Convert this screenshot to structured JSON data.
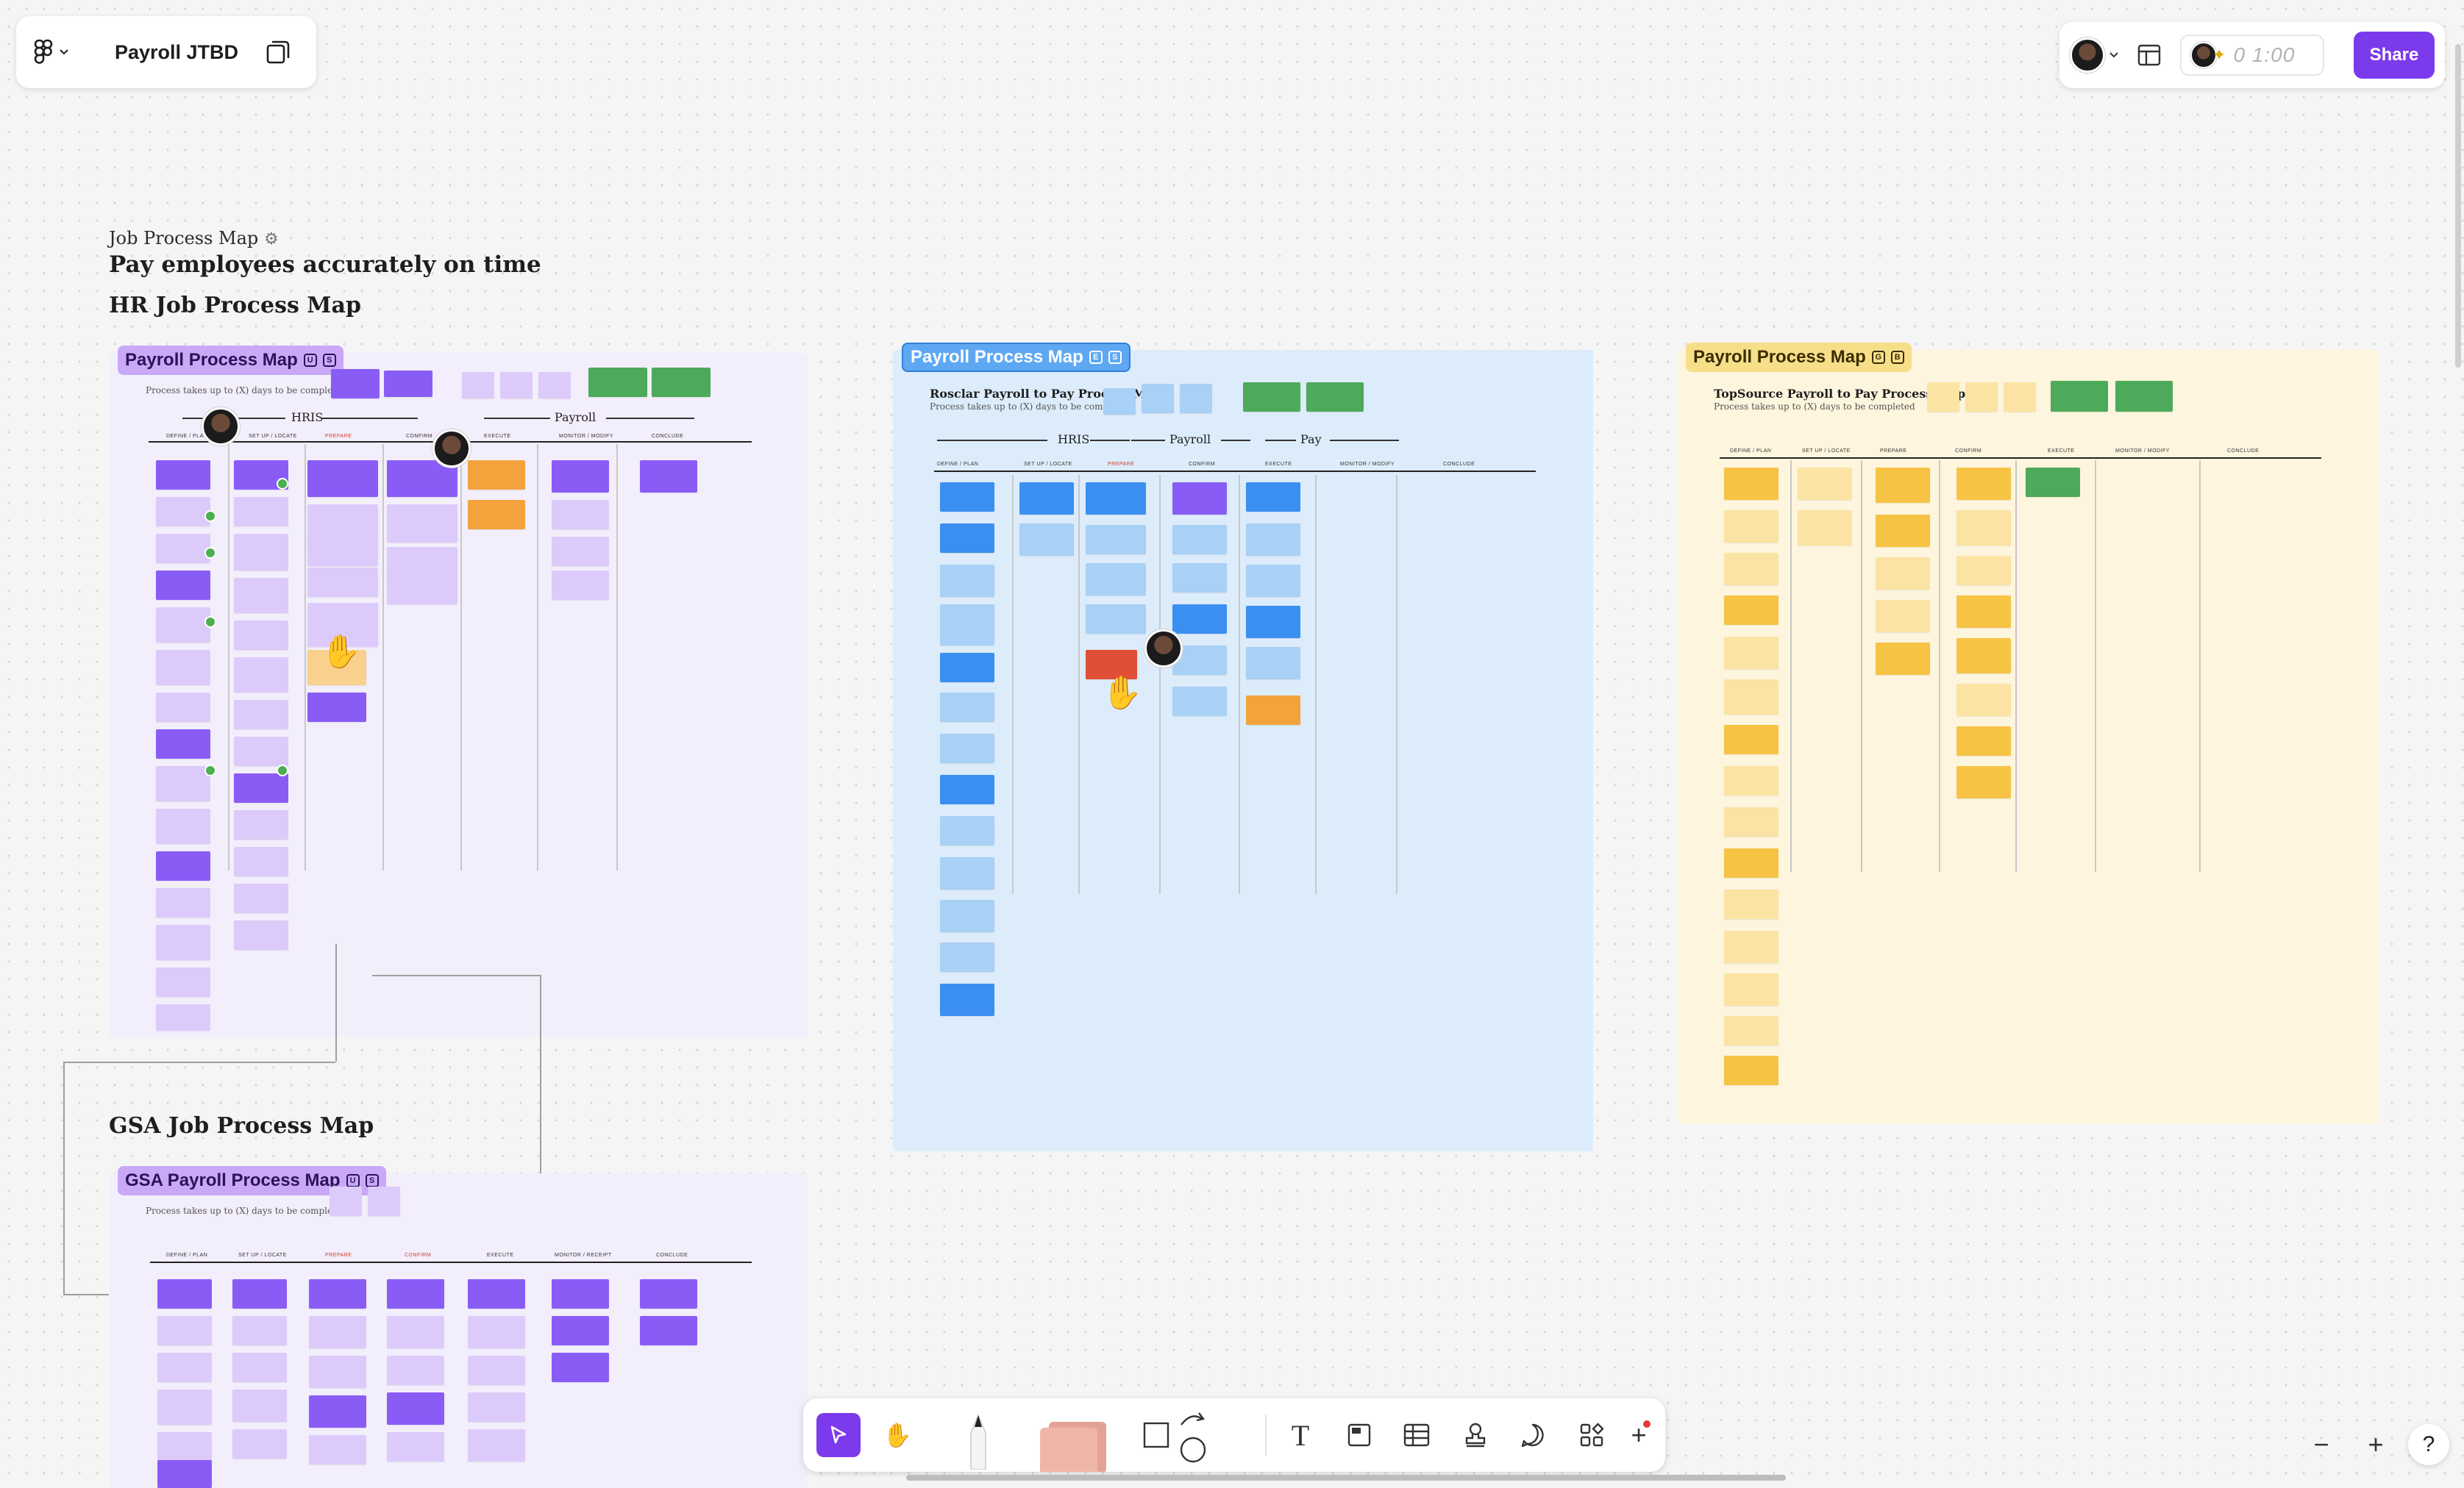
{
  "header": {
    "file_title": "Payroll JTBD",
    "share_label": "Share",
    "timer": "0 1:00"
  },
  "board": {
    "eyebrow": "Job Process Map",
    "headline": "Pay employees accurately on time",
    "hr_heading": "HR Job Process Map",
    "gsa_heading": "GSA Job Process Map"
  },
  "sections": {
    "hr": {
      "label": "Payroll Process Map",
      "keys": [
        "U",
        "S"
      ],
      "subtitle": "Process takes up to (X) days to be completed",
      "bands": [
        "HRIS",
        "Payroll"
      ],
      "stages": [
        "DEFINE / PLAN",
        "SET UP / LOCATE",
        "PREPARE",
        "CONFIRM",
        "EXECUTE",
        "MONITOR / MODIFY",
        "CONCLUDE"
      ]
    },
    "rosclar": {
      "label": "Payroll Process Map",
      "keys": [
        "E",
        "S"
      ],
      "title": "Rosclar Payroll to Pay Process Map",
      "subtitle": "Process takes up to (X) days to be completed",
      "bands": [
        "HRIS",
        "Payroll",
        "Pay"
      ],
      "stages": [
        "DEFINE / PLAN",
        "SET UP / LOCATE",
        "PREPARE",
        "CONFIRM",
        "EXECUTE",
        "MONITOR / MODIFY",
        "CONCLUDE"
      ]
    },
    "topsource": {
      "label": "Payroll Process Map",
      "keys": [
        "G",
        "B"
      ],
      "title": "TopSource Payroll to Pay Process Map",
      "subtitle": "Process takes up to (X) days to be completed",
      "stages": [
        "DEFINE / PLAN",
        "SET UP / LOCATE",
        "PREPARE",
        "CONFIRM",
        "EXECUTE",
        "MONITOR / MODIFY",
        "CONCLUDE"
      ]
    },
    "gsa": {
      "label": "GSA Payroll Process Map",
      "keys": [
        "U",
        "S"
      ],
      "subtitle": "Process takes up to (X) days to be completed",
      "stages": [
        "DEFINE / PLAN",
        "SET UP / LOCATE",
        "PREPARE",
        "CONFIRM",
        "EXECUTE",
        "MONITOR / RECEIPT",
        "CONCLUDE"
      ]
    }
  },
  "colors": {
    "accent": "#7c3aed",
    "hr_section": "#f3eefc",
    "rosclar_section": "#dcecfa",
    "topsource_section": "#fdf5dd"
  },
  "tools": [
    "select-tool",
    "hand-tool",
    "pen-tool",
    "sticky-tool",
    "shape-tool",
    "connector-tool",
    "text-tool",
    "section-tool",
    "table-tool",
    "stamp-tool",
    "comment-tool",
    "widgets-tool",
    "add-tool"
  ]
}
